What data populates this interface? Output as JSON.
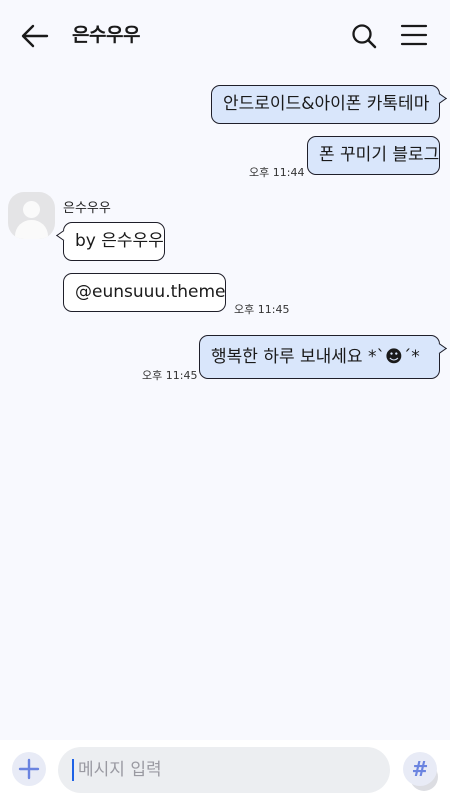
{
  "header": {
    "title": "은수우우",
    "back_icon": "arrow-left-icon",
    "search_icon": "search-icon",
    "menu_icon": "hamburger-menu-icon"
  },
  "messages": [
    {
      "side": "mine",
      "text": "안드로이드&아이폰 카톡테마"
    },
    {
      "side": "mine",
      "text": "폰 꾸미기 블로그",
      "time": "오후 11:44"
    },
    {
      "side": "theirs",
      "sender": "은수우우",
      "text": "by 은수우우"
    },
    {
      "side": "theirs",
      "text": "@eunsuuu.theme",
      "time": "오후 11:45"
    },
    {
      "side": "mine",
      "text": "행복한 하루 보내세요 *ˋ☻ˊ*",
      "time": "오후 11:45"
    }
  ],
  "footer": {
    "plus_icon": "plus-icon",
    "input_placeholder": "메시지 입력",
    "emoji_icon": "emoticon-icon",
    "hash_label": "#"
  },
  "colors": {
    "background": "#f8f9fe",
    "my_bubble": "#d9e6fb",
    "their_bubble": "#ffffff",
    "accent": "#6b84e0"
  }
}
